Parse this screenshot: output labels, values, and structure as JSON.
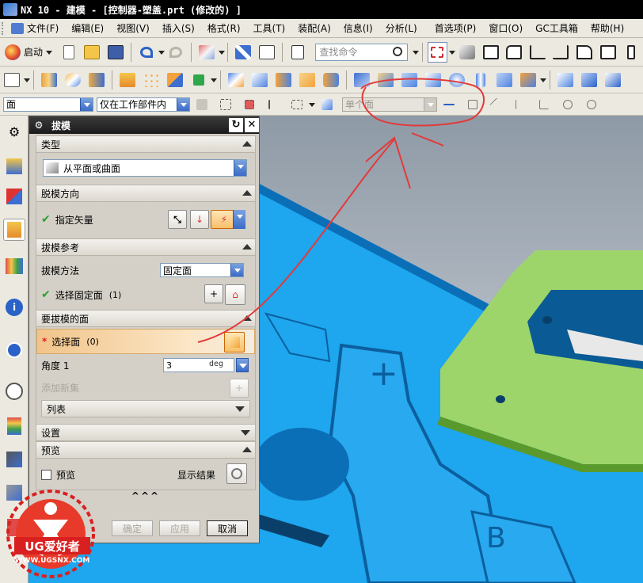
{
  "window": {
    "title": "NX 10 - 建模 - [控制器-塑盖.prt  (修改的) ]"
  },
  "menubar": {
    "items": [
      "文件(F)",
      "编辑(E)",
      "视图(V)",
      "插入(S)",
      "格式(R)",
      "工具(T)",
      "装配(A)",
      "信息(I)",
      "分析(L)",
      "首选项(P)",
      "窗口(O)",
      "GC工具箱",
      "帮助(H)"
    ]
  },
  "toolbar": {
    "start_label": "启动",
    "search_placeholder": "查找命令"
  },
  "selection_bar": {
    "filter_value": "面",
    "scope_value": "仅在工作部件内",
    "face_rule_value": "单个面"
  },
  "dialog": {
    "title": "拔模",
    "type_header": "类型",
    "type_value": "从平面或曲面",
    "direction_header": "脱模方向",
    "specify_vector_label": "指定矢量",
    "reference_header": "拔模参考",
    "method_label": "拔模方法",
    "method_value": "固定面",
    "select_fixed_face_label": "选择固定面",
    "select_fixed_face_count": "(1)",
    "faces_header": "要拔模的面",
    "select_face_label": "选择面",
    "select_face_count": "(0)",
    "angle_label": "角度 1",
    "angle_value": "3",
    "angle_unit": "deg",
    "add_new_set_label": "添加新集",
    "list_label": "列表",
    "settings_header": "设置",
    "preview_header": "预览",
    "preview_checkbox_label": "预览",
    "show_result_label": "显示结果",
    "ok_label": "确定",
    "apply_label": "应用",
    "cancel_label": "取消",
    "expand_label": "^^^"
  },
  "viewport": {
    "plus_label": "+",
    "b_label": "B"
  },
  "watermark": {
    "brand": "UG爱好者",
    "url": "WWW.UGSNX.COM"
  },
  "colors": {
    "part_blue": "#1ea6ee",
    "part_dark": "#0b6fb8",
    "fixed_face_green": "#9ed56a",
    "annotation_red": "#e23a3a",
    "highlight_orange": "#f1c48a"
  }
}
